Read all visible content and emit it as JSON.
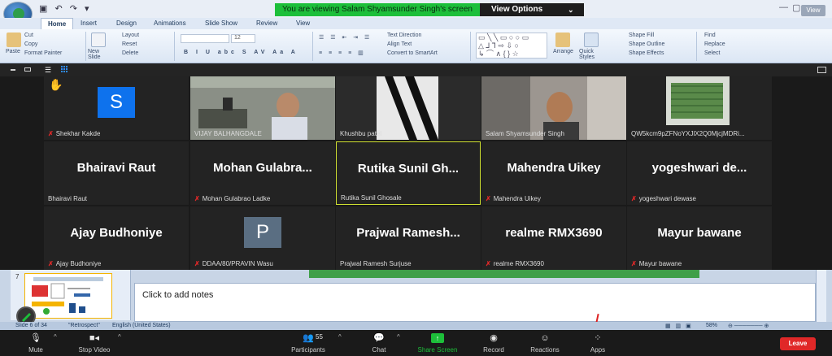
{
  "ppt": {
    "tabs": [
      "Home",
      "Insert",
      "Design",
      "Animations",
      "Slide Show",
      "Review",
      "View"
    ],
    "clipboard": {
      "cut": "Cut",
      "copy": "Copy",
      "paste": "Paste",
      "format_painter": "Format Painter"
    },
    "slides": {
      "new_slide": "New Slide",
      "layout": "Layout",
      "reset": "Reset",
      "delete": "Delete"
    },
    "font": {
      "size": "12"
    },
    "paragraph": {
      "text_direction": "Text Direction",
      "align_text": "Align Text",
      "convert_smartart": "Convert to SmartArt"
    },
    "drawing": {
      "arrange": "Arrange",
      "quick_styles": "Quick Styles",
      "shape_fill": "Shape Fill",
      "shape_outline": "Shape Outline",
      "shape_effects": "Shape Effects"
    },
    "editing": {
      "find": "Find",
      "replace": "Replace",
      "select": "Select"
    },
    "view_button": "View",
    "slide_number": "7",
    "notes_placeholder": "Click to add notes",
    "status": {
      "slide": "Slide 6 of 34",
      "theme": "\"Retrospect\"",
      "language": "English (United States)",
      "zoom": "58%"
    }
  },
  "zoom": {
    "banner": "You are viewing Salam Shyamsunder Singh's screen",
    "view_options": "View Options",
    "participants": [
      {
        "big": "",
        "name": "Shekhar Kakde",
        "muted": true,
        "avatar": "S",
        "avatar_color": "#0e72ed",
        "hand": true
      },
      {
        "big": "",
        "name": "VIJAY BALHANGDALE",
        "muted": false,
        "video": "classroom"
      },
      {
        "big": "",
        "name": "Khushbu patel",
        "muted": false,
        "video": "striped"
      },
      {
        "big": "",
        "name": "Salam Shyamsunder Singh",
        "muted": false,
        "video": "man"
      },
      {
        "big": "",
        "name": "QW5kcm9pZFNoYXJlX2Q0MjcjMDRi...",
        "muted": false,
        "video": "green"
      },
      {
        "big": "Bhairavi Raut",
        "name": "Bhairavi Raut",
        "muted": false
      },
      {
        "big": "Mohan Gulabra...",
        "name": "Mohan Gulabrao Ladke",
        "muted": true
      },
      {
        "big": "Rutika Sunil Gh...",
        "name": "Rutika Sunil Ghosale",
        "muted": false,
        "highlight": true
      },
      {
        "big": "Mahendra Uikey",
        "name": "Mahendra Uikey",
        "muted": true
      },
      {
        "big": "yogeshwari de...",
        "name": "yogeshwari dewase",
        "muted": true
      },
      {
        "big": "Ajay Budhoniye",
        "name": "Ajay Budhoniye",
        "muted": true
      },
      {
        "big": "",
        "name": "DDAA/80/PRAVIN Wasu",
        "muted": true,
        "avatar": "P",
        "avatar_color": "#5a6e82"
      },
      {
        "big": "Prajwal Ramesh...",
        "name": "Prajwal Ramesh Surjuse",
        "muted": false
      },
      {
        "big": "realme RMX3690",
        "name": "realme RMX3690",
        "muted": true
      },
      {
        "big": "Mayur bawane",
        "name": "Mayur bawane",
        "muted": true
      }
    ],
    "controls": {
      "mute": "Mute",
      "stop_video": "Stop Video",
      "participants": "Participants",
      "participant_count": "55",
      "chat": "Chat",
      "share_screen": "Share Screen",
      "record": "Record",
      "reactions": "Reactions",
      "apps": "Apps",
      "leave": "Leave"
    }
  }
}
